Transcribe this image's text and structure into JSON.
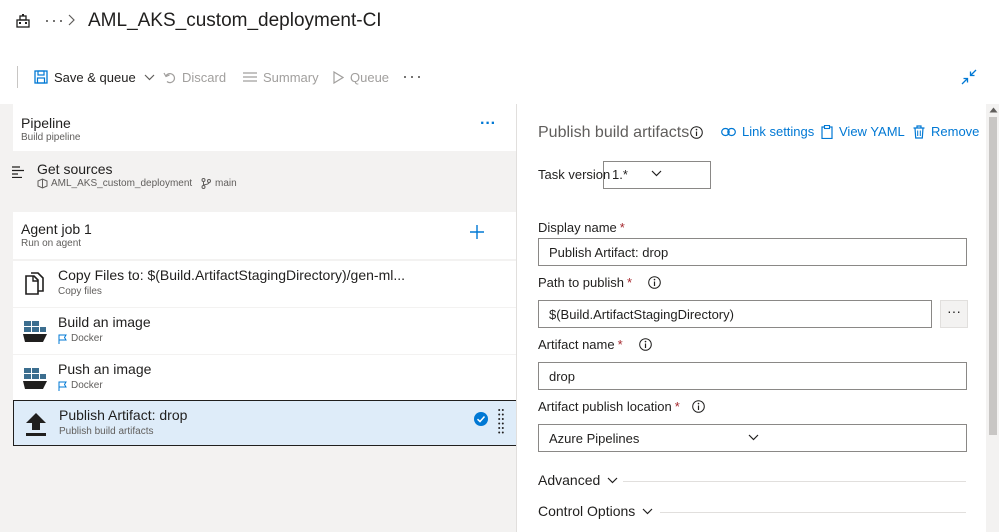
{
  "header": {
    "breadcrumb_more": "···",
    "title": "AML_AKS_custom_deployment-CI"
  },
  "toolbar": {
    "save_label": "Save & queue",
    "discard_label": "Discard",
    "summary_label": "Summary",
    "queue_label": "Queue",
    "more_label": "···"
  },
  "left": {
    "pipeline": {
      "title": "Pipeline",
      "subtitle": "Build pipeline",
      "more": "···"
    },
    "get_sources": {
      "title": "Get sources",
      "repo": "AML_AKS_custom_deployment",
      "branch": "main"
    },
    "job": {
      "title": "Agent job 1",
      "subtitle": "Run on agent"
    },
    "tasks": [
      {
        "title": "Copy Files to: $(Build.ArtifactStagingDirectory)/gen-ml...",
        "subtitle": "Copy files"
      },
      {
        "title": "Build an image",
        "subtitle": "Docker"
      },
      {
        "title": "Push an image",
        "subtitle": "Docker"
      },
      {
        "title": "Publish Artifact: drop",
        "subtitle": "Publish build artifacts"
      }
    ]
  },
  "right": {
    "heading": "Publish build artifacts",
    "link_settings": "Link settings",
    "view_yaml": "View YAML",
    "remove": "Remove",
    "task_version_label": "Task version",
    "task_version_value": "1.*",
    "display_name_label": "Display name",
    "display_name_value": "Publish Artifact: drop",
    "path_label": "Path to publish",
    "path_value": "$(Build.ArtifactStagingDirectory)",
    "path_browse": "···",
    "artifact_name_label": "Artifact name",
    "artifact_name_value": "drop",
    "location_label": "Artifact publish location",
    "location_value": "Azure Pipelines",
    "required_mark": "*",
    "advanced_label": "Advanced",
    "control_options_label": "Control Options"
  },
  "colors": {
    "accent": "#0078d4",
    "selected_row": "#deecf9",
    "panel_bg": "#f3f2f1",
    "required": "#a4262c"
  }
}
